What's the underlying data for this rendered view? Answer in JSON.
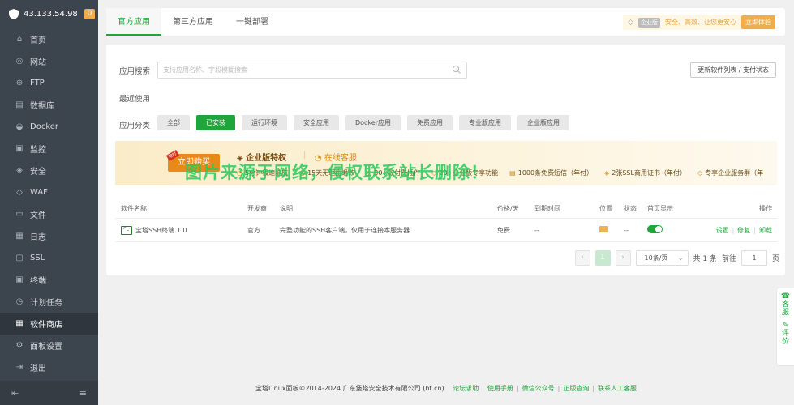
{
  "sidebar": {
    "ip": "43.133.54.98",
    "badge": "0",
    "items": [
      {
        "label": "首页",
        "icon": "home-icon",
        "glyph": "⌂"
      },
      {
        "label": "网站",
        "icon": "globe-icon",
        "glyph": "◎"
      },
      {
        "label": "FTP",
        "icon": "ftp-icon",
        "glyph": "⊕"
      },
      {
        "label": "数据库",
        "icon": "database-icon",
        "glyph": "▤"
      },
      {
        "label": "Docker",
        "icon": "docker-icon",
        "glyph": "◒"
      },
      {
        "label": "监控",
        "icon": "monitor-icon",
        "glyph": "▣"
      },
      {
        "label": "安全",
        "icon": "shield-icon",
        "glyph": "◈"
      },
      {
        "label": "WAF",
        "icon": "waf-icon",
        "glyph": "◇"
      },
      {
        "label": "文件",
        "icon": "folder-icon",
        "glyph": "▭"
      },
      {
        "label": "日志",
        "icon": "log-icon",
        "glyph": "▦"
      },
      {
        "label": "SSL",
        "icon": "ssl-icon",
        "glyph": "▢"
      },
      {
        "label": "终端",
        "icon": "terminal-icon",
        "glyph": "▣"
      },
      {
        "label": "计划任务",
        "icon": "clock-icon",
        "glyph": "◷"
      },
      {
        "label": "软件商店",
        "icon": "grid-icon",
        "glyph": "▦"
      },
      {
        "label": "面板设置",
        "icon": "gear-icon",
        "glyph": "⚙"
      },
      {
        "label": "退出",
        "icon": "logout-icon",
        "glyph": "⇥"
      }
    ]
  },
  "topbar": {
    "tabs": [
      "官方应用",
      "第三方应用",
      "一键部署"
    ],
    "promo_tag": "企业版",
    "promo_text": "安全、高效、让您更安心",
    "promo_button": "立即体验"
  },
  "search": {
    "label": "应用搜索",
    "placeholder": "支持应用名称、字段模糊搜索",
    "update_button": "更新软件列表 / 支付状态"
  },
  "recent_label": "最近使用",
  "category": {
    "label": "应用分类",
    "items": [
      "全部",
      "已安装",
      "运行环境",
      "安全应用",
      "Docker应用",
      "免费应用",
      "专业版应用",
      "企业版应用"
    ]
  },
  "banner": {
    "buy_button": "立即购买",
    "corner": "限时",
    "title": "企业版特权",
    "service": "在线客服",
    "features": [
      "5分钟极速响应",
      "15天无理由退款",
      "30+款付费插件",
      "20+企业版专享功能",
      "1000条免费短信（年付）",
      "2张SSL商用证书（年付）",
      "专享企业服务群（年"
    ],
    "watermark": "图片来源于网络，侵权联系站长删除！"
  },
  "table": {
    "headers": [
      "软件名称",
      "开发商",
      "说明",
      "价格/天",
      "到期时间",
      "位置",
      "状态",
      "首页显示",
      "操作"
    ],
    "rows": [
      {
        "name": "宝塔SSH终端 1.0",
        "dev": "官方",
        "desc": "完整功能的SSH客户端，仅用于连接本服务器",
        "price": "免费",
        "expire": "--",
        "status": "--",
        "ops": [
          "设置",
          "修复",
          "卸载"
        ]
      }
    ]
  },
  "pager": {
    "prev": "‹",
    "page": "1",
    "next": "›",
    "per_page": "10条/页",
    "total": "共 1 条",
    "goto_label": "前往",
    "goto_value": "1",
    "page_suffix": "页"
  },
  "support": [
    {
      "icon": "headset-icon",
      "label": "客服",
      "glyph": "☎"
    },
    {
      "icon": "edit-icon",
      "label": "评价",
      "glyph": "✎"
    }
  ],
  "footer": {
    "copyright": "宝塔Linux面板©2014-2024 广东堡塔安全技术有限公司 (bt.cn)",
    "links": [
      "论坛求助",
      "使用手册",
      "微信公众号",
      "正版查询",
      "联系人工客服"
    ]
  },
  "colors": {
    "accent": "#20a53a",
    "sidebar": "#3c444d",
    "promo": "#f0ad4e"
  }
}
